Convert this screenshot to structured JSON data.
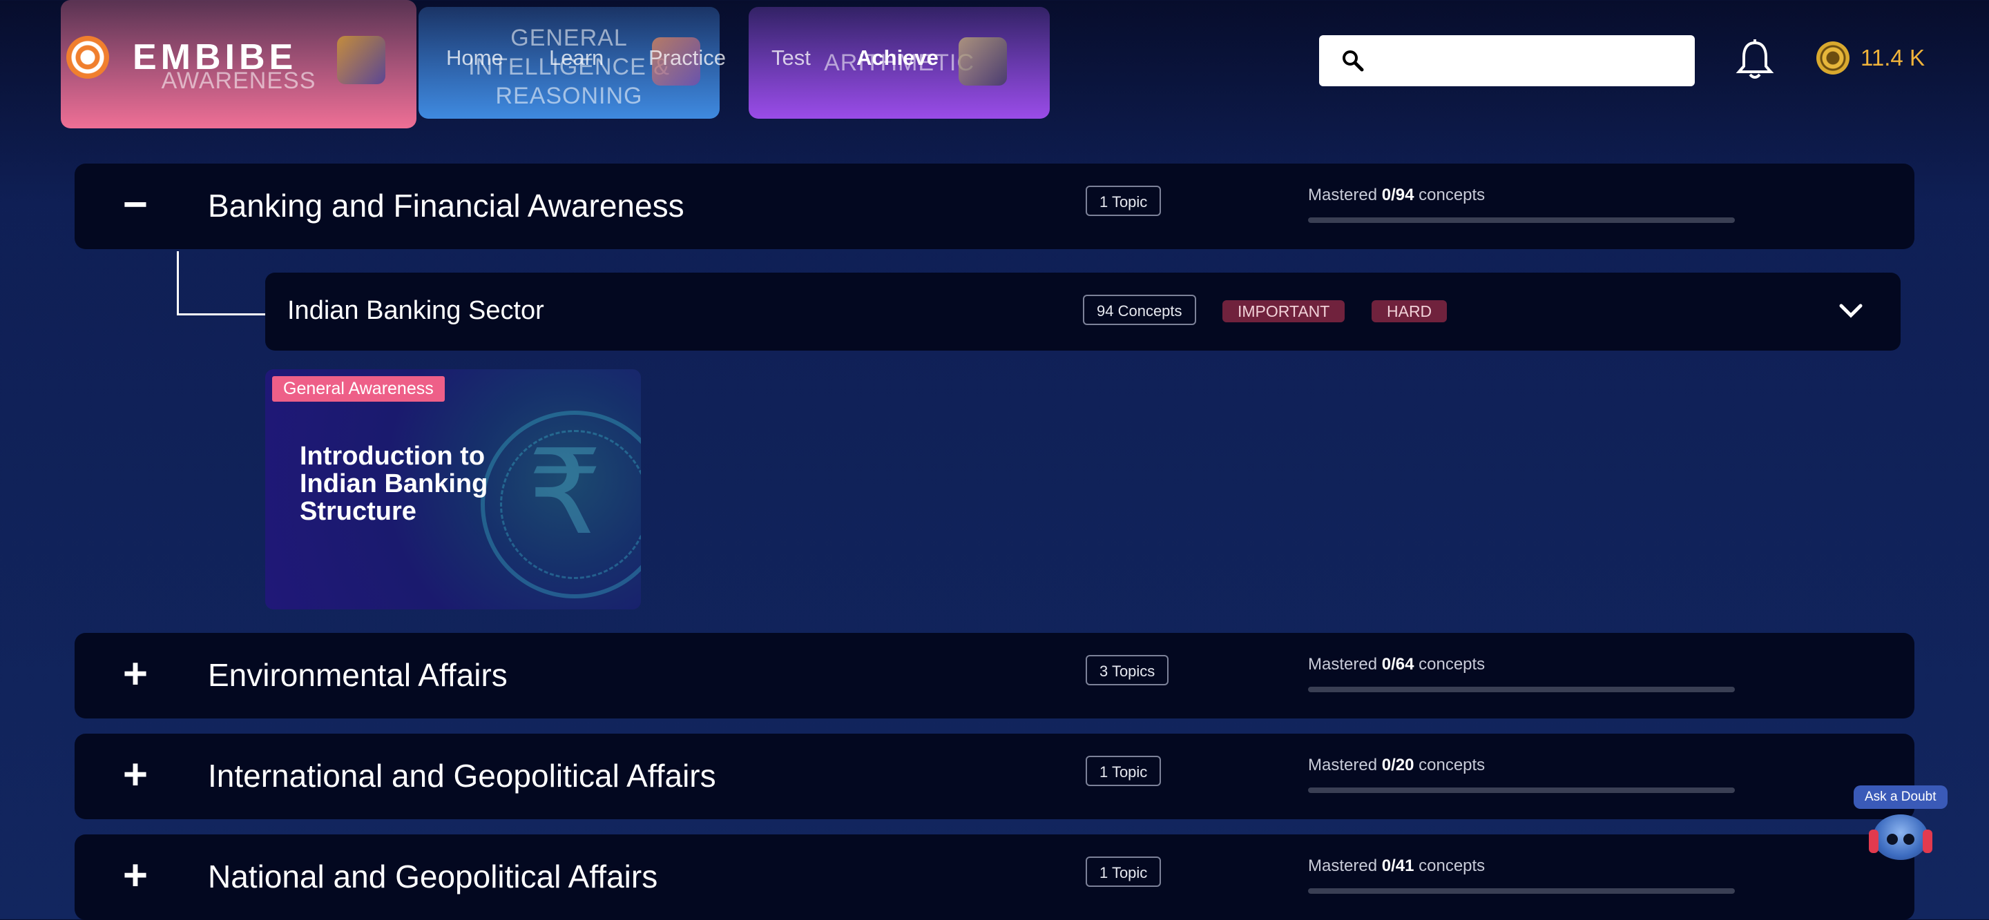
{
  "background_cards": [
    {
      "text": "AWARENESS",
      "color": "#ef6f95"
    },
    {
      "text": "GENERAL INTELLIGENCE & REASONING",
      "color": "#3f8ae0"
    },
    {
      "text": "ARITHMETIC",
      "color": "#9a4ce8"
    }
  ],
  "header": {
    "logo_text": "EMBIBE",
    "nav": [
      "Home",
      "Learn",
      "Practice",
      "Test",
      "Achieve"
    ],
    "active_nav": "Achieve",
    "search_placeholder": "",
    "coins": "11.4 K"
  },
  "subjects": [
    {
      "toggle": "−",
      "title": "Banking and Financial Awareness",
      "topics": "1 Topic",
      "mastered_prefix": "Mastered",
      "mastered_count": "0",
      "total": "/94",
      "suffix": "concepts",
      "progress": 0,
      "expanded": true
    },
    {
      "toggle": "+",
      "title": "Environmental Affairs",
      "topics": "3 Topics",
      "mastered_prefix": "Mastered",
      "mastered_count": "0",
      "total": "/64",
      "suffix": "concepts",
      "progress": 0
    },
    {
      "toggle": "+",
      "title": "International and Geopolitical Affairs",
      "topics": "1 Topic",
      "mastered_prefix": "Mastered",
      "mastered_count": "0",
      "total": "/20",
      "suffix": "concepts",
      "progress": 0
    },
    {
      "toggle": "+",
      "title": "National and Geopolitical Affairs",
      "topics": "1 Topic",
      "mastered_prefix": "Mastered",
      "mastered_count": "0",
      "total": "/41",
      "suffix": "concepts",
      "progress": 0
    }
  ],
  "topic": {
    "title": "Indian Banking Sector",
    "concepts": "94 Concepts",
    "tags": [
      "IMPORTANT",
      "HARD"
    ]
  },
  "card": {
    "label": "General Awareness",
    "heading": "Introduction to Indian Banking Structure"
  },
  "ask_doubt": "Ask a Doubt"
}
